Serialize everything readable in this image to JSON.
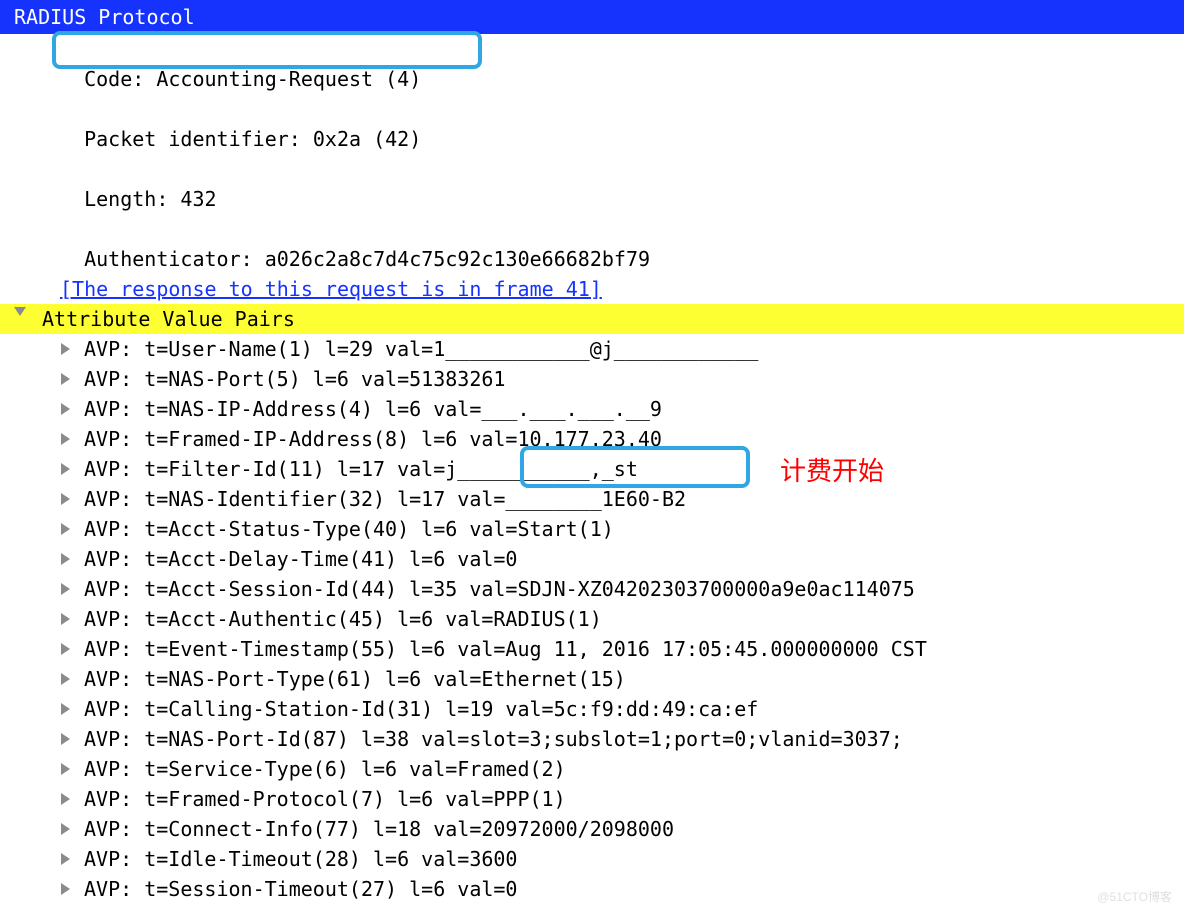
{
  "header": {
    "title": "RADIUS Protocol"
  },
  "fields": {
    "code": "Code: Accounting-Request (4)",
    "packet_id": "Packet identifier: 0x2a (42)",
    "length": "Length: 432",
    "authenticator": "Authenticator: a026c2a8c7d4c75c92c130e66682bf79",
    "response_link": "[The response to this request is in frame 41]"
  },
  "avp_section": {
    "label": "Attribute Value Pairs"
  },
  "avps": [
    "AVP: t=User-Name(1) l=29 val=1____________@j____________",
    "AVP: t=NAS-Port(5) l=6 val=51383261",
    "AVP: t=NAS-IP-Address(4) l=6 val=___.___.___.__9",
    "AVP: t=Framed-IP-Address(8) l=6 val=10.177.23.40",
    "AVP: t=Filter-Id(11) l=17 val=j___________,_st",
    "AVP: t=NAS-Identifier(32) l=17 val=________1E60-B2",
    "AVP: t=Acct-Status-Type(40) l=6 val=Start(1)",
    "AVP: t=Acct-Delay-Time(41) l=6 val=0",
    "AVP: t=Acct-Session-Id(44) l=35 val=SDJN-XZ04202303700000a9e0ac114075",
    "AVP: t=Acct-Authentic(45) l=6 val=RADIUS(1)",
    "AVP: t=Event-Timestamp(55) l=6 val=Aug 11, 2016 17:05:45.000000000 CST",
    "AVP: t=NAS-Port-Type(61) l=6 val=Ethernet(15)",
    "AVP: t=Calling-Station-Id(31) l=19 val=5c:f9:dd:49:ca:ef",
    "AVP: t=NAS-Port-Id(87) l=38 val=slot=3;subslot=1;port=0;vlanid=3037;",
    "AVP: t=Service-Type(6) l=6 val=Framed(2)",
    "AVP: t=Framed-Protocol(7) l=6 val=PPP(1)",
    "AVP: t=Connect-Info(77) l=18 val=20972000/2098000",
    "AVP: t=Idle-Timeout(28) l=6 val=3600",
    "AVP: t=Session-Timeout(27) l=6 val=0"
  ],
  "annotation": {
    "start_label": "计费开始"
  },
  "watermark": "@51CTO博客"
}
